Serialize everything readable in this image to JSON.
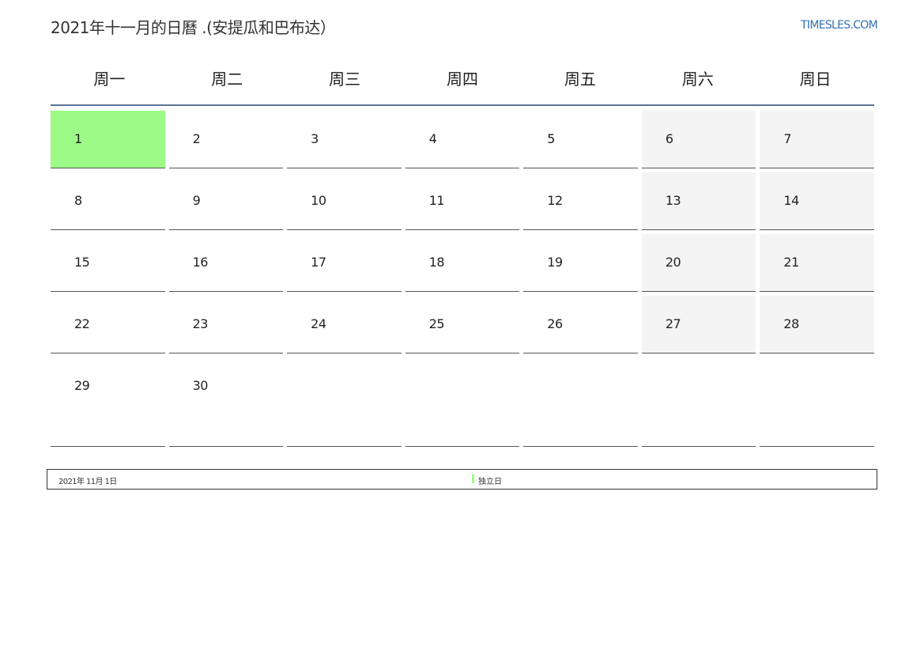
{
  "header": {
    "title": "2021年十一月的日曆 .(安提瓜和巴布达）",
    "site": "TIMESLES.COM"
  },
  "weekdays": [
    "周一",
    "周二",
    "周三",
    "周四",
    "周五",
    "周六",
    "周日"
  ],
  "weeks": [
    [
      "1",
      "2",
      "3",
      "4",
      "5",
      "6",
      "7"
    ],
    [
      "8",
      "9",
      "10",
      "11",
      "12",
      "13",
      "14"
    ],
    [
      "15",
      "16",
      "17",
      "18",
      "19",
      "20",
      "21"
    ],
    [
      "22",
      "23",
      "24",
      "25",
      "26",
      "27",
      "28"
    ],
    [
      "29",
      "30",
      "",
      "",
      "",
      "",
      ""
    ]
  ],
  "colors": {
    "holiday_highlight": "#9cfa86",
    "weekend_background": "#f4f4f4",
    "header_rule": "#5a7396",
    "link": "#2f6fb3"
  },
  "holidays": [
    {
      "date": "2021年 11月 1日",
      "name": "独立日"
    }
  ]
}
